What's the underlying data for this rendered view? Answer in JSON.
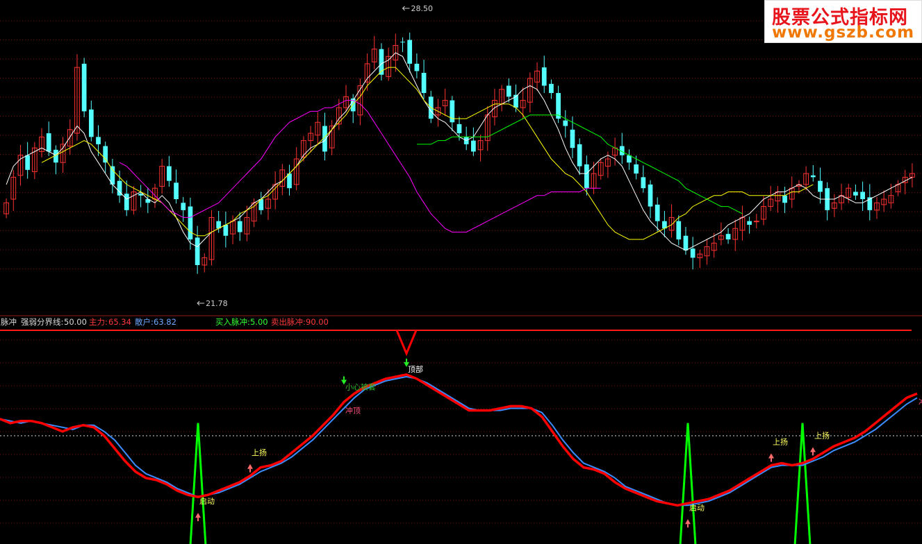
{
  "watermark": {
    "cn": "股票公式指标网",
    "url": "www.gszb.com"
  },
  "indicator_header": {
    "name": "脉冲",
    "dividing_line_label": "强弱分界线:",
    "dividing_line_value": "50.00",
    "main_force_label": "主力:",
    "main_force_value": "65.34",
    "retail_label": "散户:",
    "retail_value": "63.82",
    "buy_pulse_label": "买入脉冲:",
    "buy_pulse_value": "5.00",
    "sell_pulse_label": "卖出脉冲:",
    "sell_pulse_value": "90.00"
  },
  "colors": {
    "up_candle": "#ff3232",
    "down_candle": "#54ffff",
    "ma_short": "#ffffff",
    "ma_mid": "#ffff00",
    "ma_long": "#ff00ff",
    "ma_longest": "#00ff00",
    "main_force": "#ff0000",
    "retail": "#3c8cff",
    "buy_pulse": "#00ff00",
    "sell_pulse": "#ff0000",
    "grid": "#7a1010"
  },
  "chart_data": [
    {
      "type": "candlestick",
      "price_marks": [
        {
          "label": "28.50",
          "kind": "high"
        },
        {
          "label": "21.78",
          "kind": "low"
        }
      ],
      "ylim": [
        21.0,
        29.0
      ],
      "series": [
        {
          "name": "close",
          "values": [
            23.8,
            24.5,
            25.1,
            24.7,
            25.3,
            25.6,
            25.2,
            24.9,
            25.4,
            25.8,
            27.5,
            26.3,
            25.6,
            25.4,
            24.9,
            24.3,
            24.0,
            23.6,
            24.1,
            24.0,
            23.8,
            24.2,
            24.8,
            24.4,
            23.9,
            23.6,
            22.8,
            22.1,
            22.3,
            23.4,
            23.1,
            22.9,
            23.3,
            23.0,
            23.4,
            23.8,
            23.6,
            23.9,
            24.3,
            24.7,
            24.2,
            25.0,
            25.5,
            25.7,
            26.0,
            25.2,
            25.9,
            26.4,
            26.7,
            26.3,
            27.0,
            27.6,
            28.0,
            27.3,
            27.8,
            28.1,
            28.2,
            27.6,
            27.4,
            26.8,
            26.1,
            26.4,
            26.6,
            26.0,
            25.7,
            25.4,
            25.2,
            25.5,
            26.2,
            26.6,
            26.9,
            26.7,
            26.4,
            26.6,
            27.2,
            27.4,
            27.0,
            26.8,
            26.1,
            25.9,
            25.3,
            24.8,
            24.2,
            24.6,
            24.9,
            25.0,
            25.3,
            25.1,
            24.9,
            24.6,
            24.2,
            23.7,
            23.3,
            23.1,
            23.4,
            22.8,
            22.5,
            22.3,
            22.4,
            22.6,
            22.7,
            22.9,
            22.8,
            23.1,
            23.4,
            23.2,
            23.3,
            23.7,
            23.9,
            24.1,
            23.8,
            24.2,
            24.3,
            24.6,
            24.5,
            24.1,
            23.6,
            23.8,
            24.0,
            24.2,
            24.0,
            23.9,
            23.6,
            23.8,
            23.9,
            24.0,
            24.3,
            24.5,
            24.6
          ]
        },
        {
          "name": "ma_short",
          "values": [
            24.3,
            24.8,
            25.0,
            25.1,
            25.2,
            25.3,
            25.2,
            25.1,
            25.3,
            25.6,
            25.9,
            25.7,
            25.2,
            24.9,
            24.6,
            24.3,
            24.1,
            23.9,
            24.0,
            24.1,
            23.9,
            23.8,
            24.0,
            23.8,
            23.4,
            23.0,
            22.7,
            22.6,
            22.8,
            23.0,
            23.1,
            23.2,
            23.3,
            23.4,
            23.6,
            23.8,
            23.9,
            24.1,
            24.3,
            24.4,
            24.6,
            24.8,
            25.1,
            25.3,
            25.4,
            25.5,
            25.8,
            26.1,
            26.3,
            26.6,
            26.9,
            27.2,
            27.4,
            27.6,
            27.7,
            27.9,
            27.8,
            27.4,
            27.0,
            26.6,
            26.3,
            26.1,
            26.0,
            25.8,
            25.6,
            25.5,
            25.6,
            25.9,
            26.2,
            26.4,
            26.5,
            26.6,
            26.7,
            26.9,
            27.0,
            26.9,
            26.6,
            26.2,
            25.8,
            25.3,
            24.9,
            24.6,
            24.6,
            24.8,
            25.0,
            25.1,
            25.0,
            24.8,
            24.4,
            24.0,
            23.6,
            23.3,
            23.1,
            22.9,
            22.7,
            22.6,
            22.5,
            22.6,
            22.7,
            22.8,
            22.9,
            23.0,
            23.2,
            23.3,
            23.4,
            23.5,
            23.7,
            23.9,
            24.0,
            24.1,
            24.1,
            24.2,
            24.3,
            24.2,
            24.0,
            23.9,
            23.9,
            23.9,
            24.0,
            23.9,
            23.8,
            23.8,
            23.9,
            24.0,
            24.1,
            24.2,
            24.3,
            24.4,
            24.5
          ]
        },
        {
          "name": "ma_mid",
          "values": [
            null,
            null,
            null,
            null,
            null,
            24.9,
            25.0,
            25.1,
            25.2,
            25.3,
            25.4,
            25.5,
            25.4,
            25.2,
            25.0,
            24.7,
            24.5,
            24.3,
            24.2,
            24.1,
            24.0,
            23.9,
            23.8,
            23.6,
            23.4,
            23.2,
            23.0,
            22.9,
            22.9,
            23.0,
            23.1,
            23.2,
            23.3,
            23.5,
            23.6,
            23.7,
            23.9,
            24.0,
            24.2,
            24.4,
            24.6,
            24.8,
            25.0,
            25.2,
            25.4,
            25.6,
            25.8,
            26.0,
            26.2,
            26.5,
            26.7,
            27.0,
            27.2,
            27.4,
            27.5,
            27.5,
            27.3,
            27.1,
            26.9,
            26.6,
            26.4,
            26.3,
            26.2,
            26.1,
            26.1,
            26.1,
            26.2,
            26.3,
            26.4,
            26.5,
            26.5,
            26.5,
            26.4,
            26.2,
            25.9,
            25.6,
            25.3,
            25.0,
            24.8,
            24.6,
            24.5,
            24.3,
            24.1,
            23.8,
            23.5,
            23.2,
            23.0,
            22.9,
            22.8,
            22.8,
            22.8,
            22.9,
            23.0,
            23.1,
            23.2,
            23.4,
            23.5,
            23.7,
            23.8,
            23.9,
            24.0,
            24.0,
            24.1,
            24.1,
            24.1,
            24.0,
            24.0,
            24.0,
            24.0,
            24.0,
            24.0,
            24.1,
            24.1,
            24.2,
            24.3
          ]
        },
        {
          "name": "ma_long",
          "values": [
            null,
            null,
            null,
            null,
            null,
            null,
            null,
            null,
            null,
            null,
            null,
            null,
            null,
            null,
            null,
            null,
            24.9,
            24.8,
            24.6,
            24.4,
            24.2,
            24.0,
            23.8,
            23.6,
            23.5,
            23.4,
            23.4,
            23.5,
            23.6,
            23.7,
            23.8,
            24.0,
            24.2,
            24.4,
            24.6,
            24.8,
            25.0,
            25.3,
            25.6,
            25.8,
            26.0,
            26.1,
            26.2,
            26.3,
            26.3,
            26.4,
            26.4,
            26.5,
            26.6,
            26.6,
            26.5,
            26.3,
            26.0,
            25.7,
            25.4,
            25.1,
            24.8,
            24.5,
            24.1,
            23.8,
            23.5,
            23.3,
            23.1,
            23.0,
            23.0,
            23.0,
            23.1,
            23.2,
            23.3,
            23.4,
            23.5,
            23.6,
            23.7,
            23.8,
            23.9,
            24.0,
            24.0,
            24.1,
            24.1,
            24.1,
            24.1,
            24.1,
            24.2,
            24.2,
            24.2
          ]
        },
        {
          "name": "ma_longest",
          "values": [
            null,
            null,
            null,
            null,
            null,
            null,
            null,
            null,
            null,
            null,
            null,
            null,
            null,
            null,
            null,
            null,
            null,
            null,
            null,
            null,
            null,
            null,
            null,
            null,
            null,
            null,
            null,
            null,
            null,
            null,
            null,
            null,
            null,
            null,
            null,
            null,
            null,
            null,
            null,
            null,
            null,
            null,
            null,
            null,
            null,
            null,
            null,
            null,
            null,
            null,
            null,
            null,
            null,
            null,
            null,
            null,
            null,
            null,
            25.4,
            25.4,
            25.4,
            25.5,
            25.5,
            25.6,
            25.6,
            25.6,
            25.6,
            25.6,
            25.6,
            25.7,
            25.8,
            25.9,
            26.0,
            26.1,
            26.2,
            26.2,
            26.2,
            26.2,
            26.2,
            26.1,
            26.0,
            25.9,
            25.8,
            25.7,
            25.6,
            25.4,
            25.3,
            25.2,
            25.1,
            25.0,
            24.9,
            24.8,
            24.7,
            24.6,
            24.5,
            24.4,
            24.2,
            24.1,
            24.0,
            23.9,
            23.8,
            23.7,
            23.7,
            23.6,
            23.5
          ]
        }
      ]
    },
    {
      "type": "line",
      "ylim": [
        0,
        100
      ],
      "reference_lines": [
        50,
        90,
        5
      ],
      "annotations": [
        {
          "text": "小心被套",
          "index": 33
        },
        {
          "text": "顶部",
          "index": 39
        },
        {
          "text": "冲顶",
          "index": 33
        },
        {
          "text": "上扬",
          "index": 24
        },
        {
          "text": "启动",
          "index": 19
        },
        {
          "text": "上扬",
          "index": 74
        },
        {
          "text": "上扬",
          "index": 78
        },
        {
          "text": "启动",
          "index": 66
        },
        {
          "text": "冲顶",
          "index": 88
        }
      ],
      "series": [
        {
          "name": "主力",
          "values": [
            58,
            56,
            57,
            57,
            56,
            54,
            52,
            54,
            55,
            54,
            50,
            44,
            38,
            33,
            30,
            29,
            27,
            24,
            22,
            21,
            22,
            24,
            26,
            28,
            31,
            35,
            36,
            38,
            42,
            46,
            50,
            55,
            60,
            66,
            70,
            73,
            75,
            77,
            78,
            79,
            77,
            74,
            71,
            68,
            65,
            62,
            62,
            62,
            63,
            64,
            64,
            63,
            59,
            52,
            45,
            39,
            35,
            34,
            32,
            28,
            25,
            23,
            21,
            19,
            18,
            17,
            18,
            19,
            20,
            22,
            24,
            27,
            30,
            33,
            36,
            37,
            36,
            37,
            39,
            42,
            45,
            47,
            49,
            52,
            56,
            60,
            64,
            68,
            70
          ]
        },
        {
          "name": "散户",
          "values": [
            58,
            57,
            56,
            57,
            56,
            55,
            54,
            53,
            55,
            55,
            52,
            48,
            42,
            36,
            32,
            30,
            28,
            25,
            23,
            21,
            22,
            23,
            25,
            27,
            30,
            33,
            35,
            37,
            40,
            44,
            48,
            53,
            58,
            63,
            68,
            72,
            74,
            76,
            77,
            78,
            77,
            75,
            72,
            69,
            66,
            63,
            62,
            62,
            62,
            63,
            63,
            63,
            61,
            55,
            48,
            42,
            37,
            35,
            33,
            30,
            26,
            24,
            22,
            20,
            18,
            17,
            17,
            18,
            19,
            21,
            23,
            26,
            29,
            32,
            35,
            36,
            36,
            36,
            38,
            40,
            43,
            45,
            47,
            50,
            53,
            57,
            61,
            65,
            68
          ]
        },
        {
          "name": "卖出脉冲",
          "values": [
            {
              "index": 39,
              "value": 89
            }
          ]
        },
        {
          "name": "买入脉冲",
          "values": [
            {
              "index": 19,
              "value": 44
            },
            {
              "index": 66,
              "value": 44
            },
            {
              "index": 77,
              "value": 44
            }
          ]
        }
      ]
    }
  ]
}
